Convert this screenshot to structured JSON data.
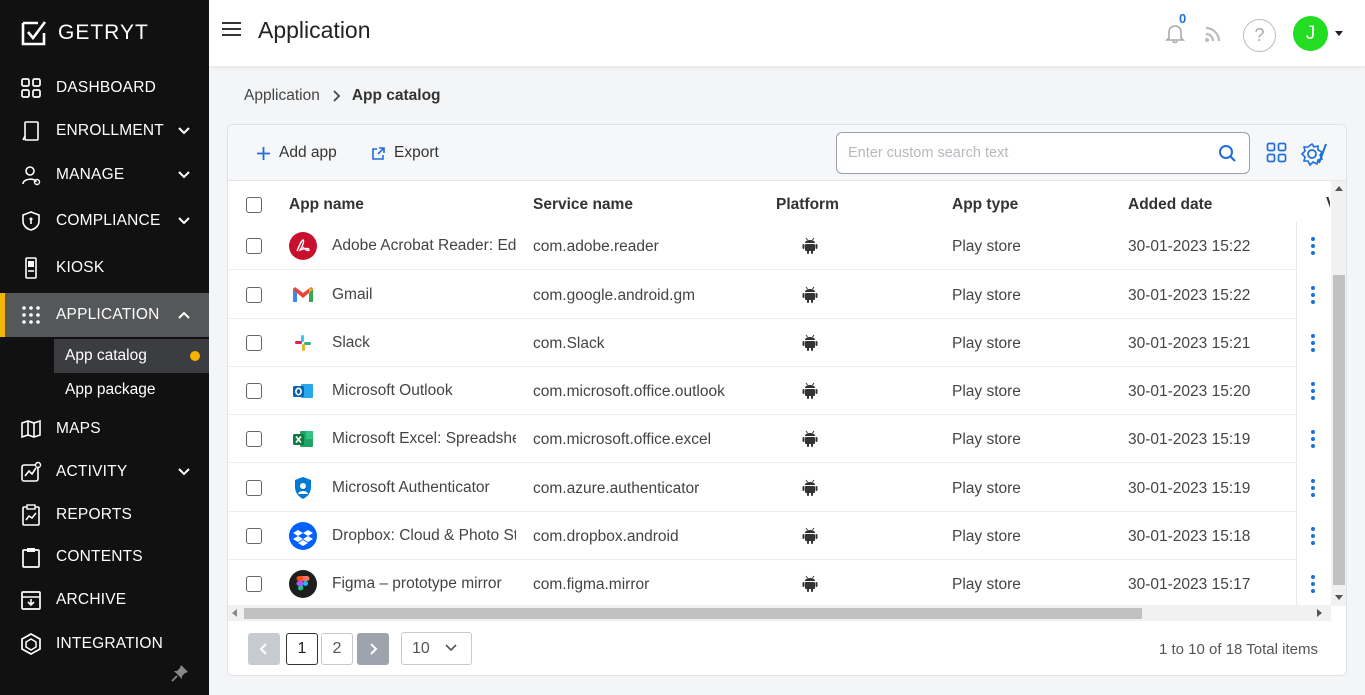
{
  "brand": {
    "name": "GETRYT"
  },
  "sidebar": {
    "items": [
      {
        "label": "DASHBOARD",
        "icon": "dashboard-icon"
      },
      {
        "label": "ENROLLMENT",
        "icon": "enrollment-icon",
        "expandable": true
      },
      {
        "label": "MANAGE",
        "icon": "manage-icon",
        "expandable": true
      },
      {
        "label": "COMPLIANCE",
        "icon": "shield-icon",
        "expandable": true
      },
      {
        "label": "KIOSK",
        "icon": "kiosk-icon"
      },
      {
        "label": "APPLICATION",
        "icon": "apps-grid-icon",
        "expandable": true,
        "active": true
      },
      {
        "label": "MAPS",
        "icon": "map-icon"
      },
      {
        "label": "ACTIVITY",
        "icon": "activity-icon",
        "expandable": true
      },
      {
        "label": "REPORTS",
        "icon": "reports-icon"
      },
      {
        "label": "CONTENTS",
        "icon": "clipboard-icon"
      },
      {
        "label": "ARCHIVE",
        "icon": "archive-icon"
      },
      {
        "label": "INTEGRATION",
        "icon": "integration-icon"
      }
    ],
    "subitems": [
      {
        "label": "App catalog",
        "active": true
      },
      {
        "label": "App package"
      }
    ]
  },
  "header": {
    "title": "Application",
    "notification_count": "0",
    "help_label": "?",
    "avatar_initial": "J"
  },
  "breadcrumb": {
    "parent": "Application",
    "current": "App catalog"
  },
  "toolbar": {
    "add_label": "Add app",
    "export_label": "Export",
    "search_placeholder": "Enter custom search text"
  },
  "table": {
    "columns": [
      "App name",
      "Service name",
      "Platform",
      "App type",
      "Added date"
    ],
    "truncated_column": "V",
    "rows": [
      {
        "app": "Adobe Acrobat Reader: Edit PDF",
        "service": "com.adobe.reader",
        "platform": "android",
        "type": "Play store",
        "date": "30-01-2023 15:22",
        "icon": "adobe-acrobat-icon"
      },
      {
        "app": "Gmail",
        "service": "com.google.android.gm",
        "platform": "android",
        "type": "Play store",
        "date": "30-01-2023 15:22",
        "icon": "gmail-icon"
      },
      {
        "app": "Slack",
        "service": "com.Slack",
        "platform": "android",
        "type": "Play store",
        "date": "30-01-2023 15:21",
        "icon": "slack-icon"
      },
      {
        "app": "Microsoft Outlook",
        "service": "com.microsoft.office.outlook",
        "platform": "android",
        "type": "Play store",
        "date": "30-01-2023 15:20",
        "icon": "outlook-icon"
      },
      {
        "app": "Microsoft Excel: Spreadsheets",
        "service": "com.microsoft.office.excel",
        "platform": "android",
        "type": "Play store",
        "date": "30-01-2023 15:19",
        "icon": "excel-icon"
      },
      {
        "app": "Microsoft Authenticator",
        "service": "com.azure.authenticator",
        "platform": "android",
        "type": "Play store",
        "date": "30-01-2023 15:19",
        "icon": "authenticator-icon"
      },
      {
        "app": "Dropbox: Cloud & Photo Storage",
        "service": "com.dropbox.android",
        "platform": "android",
        "type": "Play store",
        "date": "30-01-2023 15:18",
        "icon": "dropbox-icon"
      },
      {
        "app": "Figma – prototype mirror",
        "service": "com.figma.mirror",
        "platform": "android",
        "type": "Play store",
        "date": "30-01-2023 15:17",
        "icon": "figma-icon"
      }
    ]
  },
  "pagination": {
    "pages": [
      "1",
      "2"
    ],
    "current_page": "1",
    "page_size": "10",
    "info": "1 to 10 of 18 Total items"
  },
  "colors": {
    "sidebar_bg": "#111111",
    "active_accent": "#f5b400",
    "link_blue": "#1e6fd9",
    "avatar_green": "#22dd22"
  }
}
